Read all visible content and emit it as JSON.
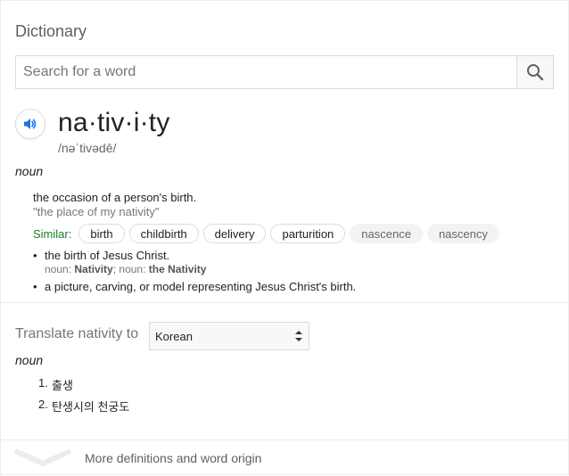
{
  "title": "Dictionary",
  "search": {
    "placeholder": "Search for a word",
    "value": ""
  },
  "entry": {
    "headword": "na·tiv·i·ty",
    "phonetic": "/nəˈtivədē/",
    "part_of_speech": "noun",
    "definition": "the occasion of a person's birth.",
    "example": "\"the place of my nativity\"",
    "similar_label": "Similar:",
    "similar": [
      "birth",
      "childbirth",
      "delivery",
      "parturition"
    ],
    "similar_muted": [
      "nascence",
      "nascency"
    ],
    "senses": [
      {
        "text": "the birth of Jesus Christ.",
        "sub_prefix1": "noun:",
        "sub_term1": "Nativity",
        "sub_sep": "; noun:",
        "sub_term2": "the Nativity"
      },
      {
        "text": "a picture, carving, or model representing Jesus Christ's birth."
      }
    ]
  },
  "translate": {
    "label": "Translate nativity to",
    "language": "Korean",
    "part_of_speech": "noun",
    "items": [
      {
        "num": "1.",
        "text": "출생"
      },
      {
        "num": "2.",
        "text": "탄생시의 천궁도"
      }
    ]
  },
  "more_label": "More definitions and word origin",
  "icons": {
    "search": "search-icon",
    "speaker": "speaker-icon",
    "select_arrows": "updown-arrows-icon",
    "expand": "chevron-down-icon"
  },
  "colors": {
    "accent_blue": "#1a73e8",
    "similar_green": "#1a7d2c",
    "muted_text": "#777777"
  }
}
